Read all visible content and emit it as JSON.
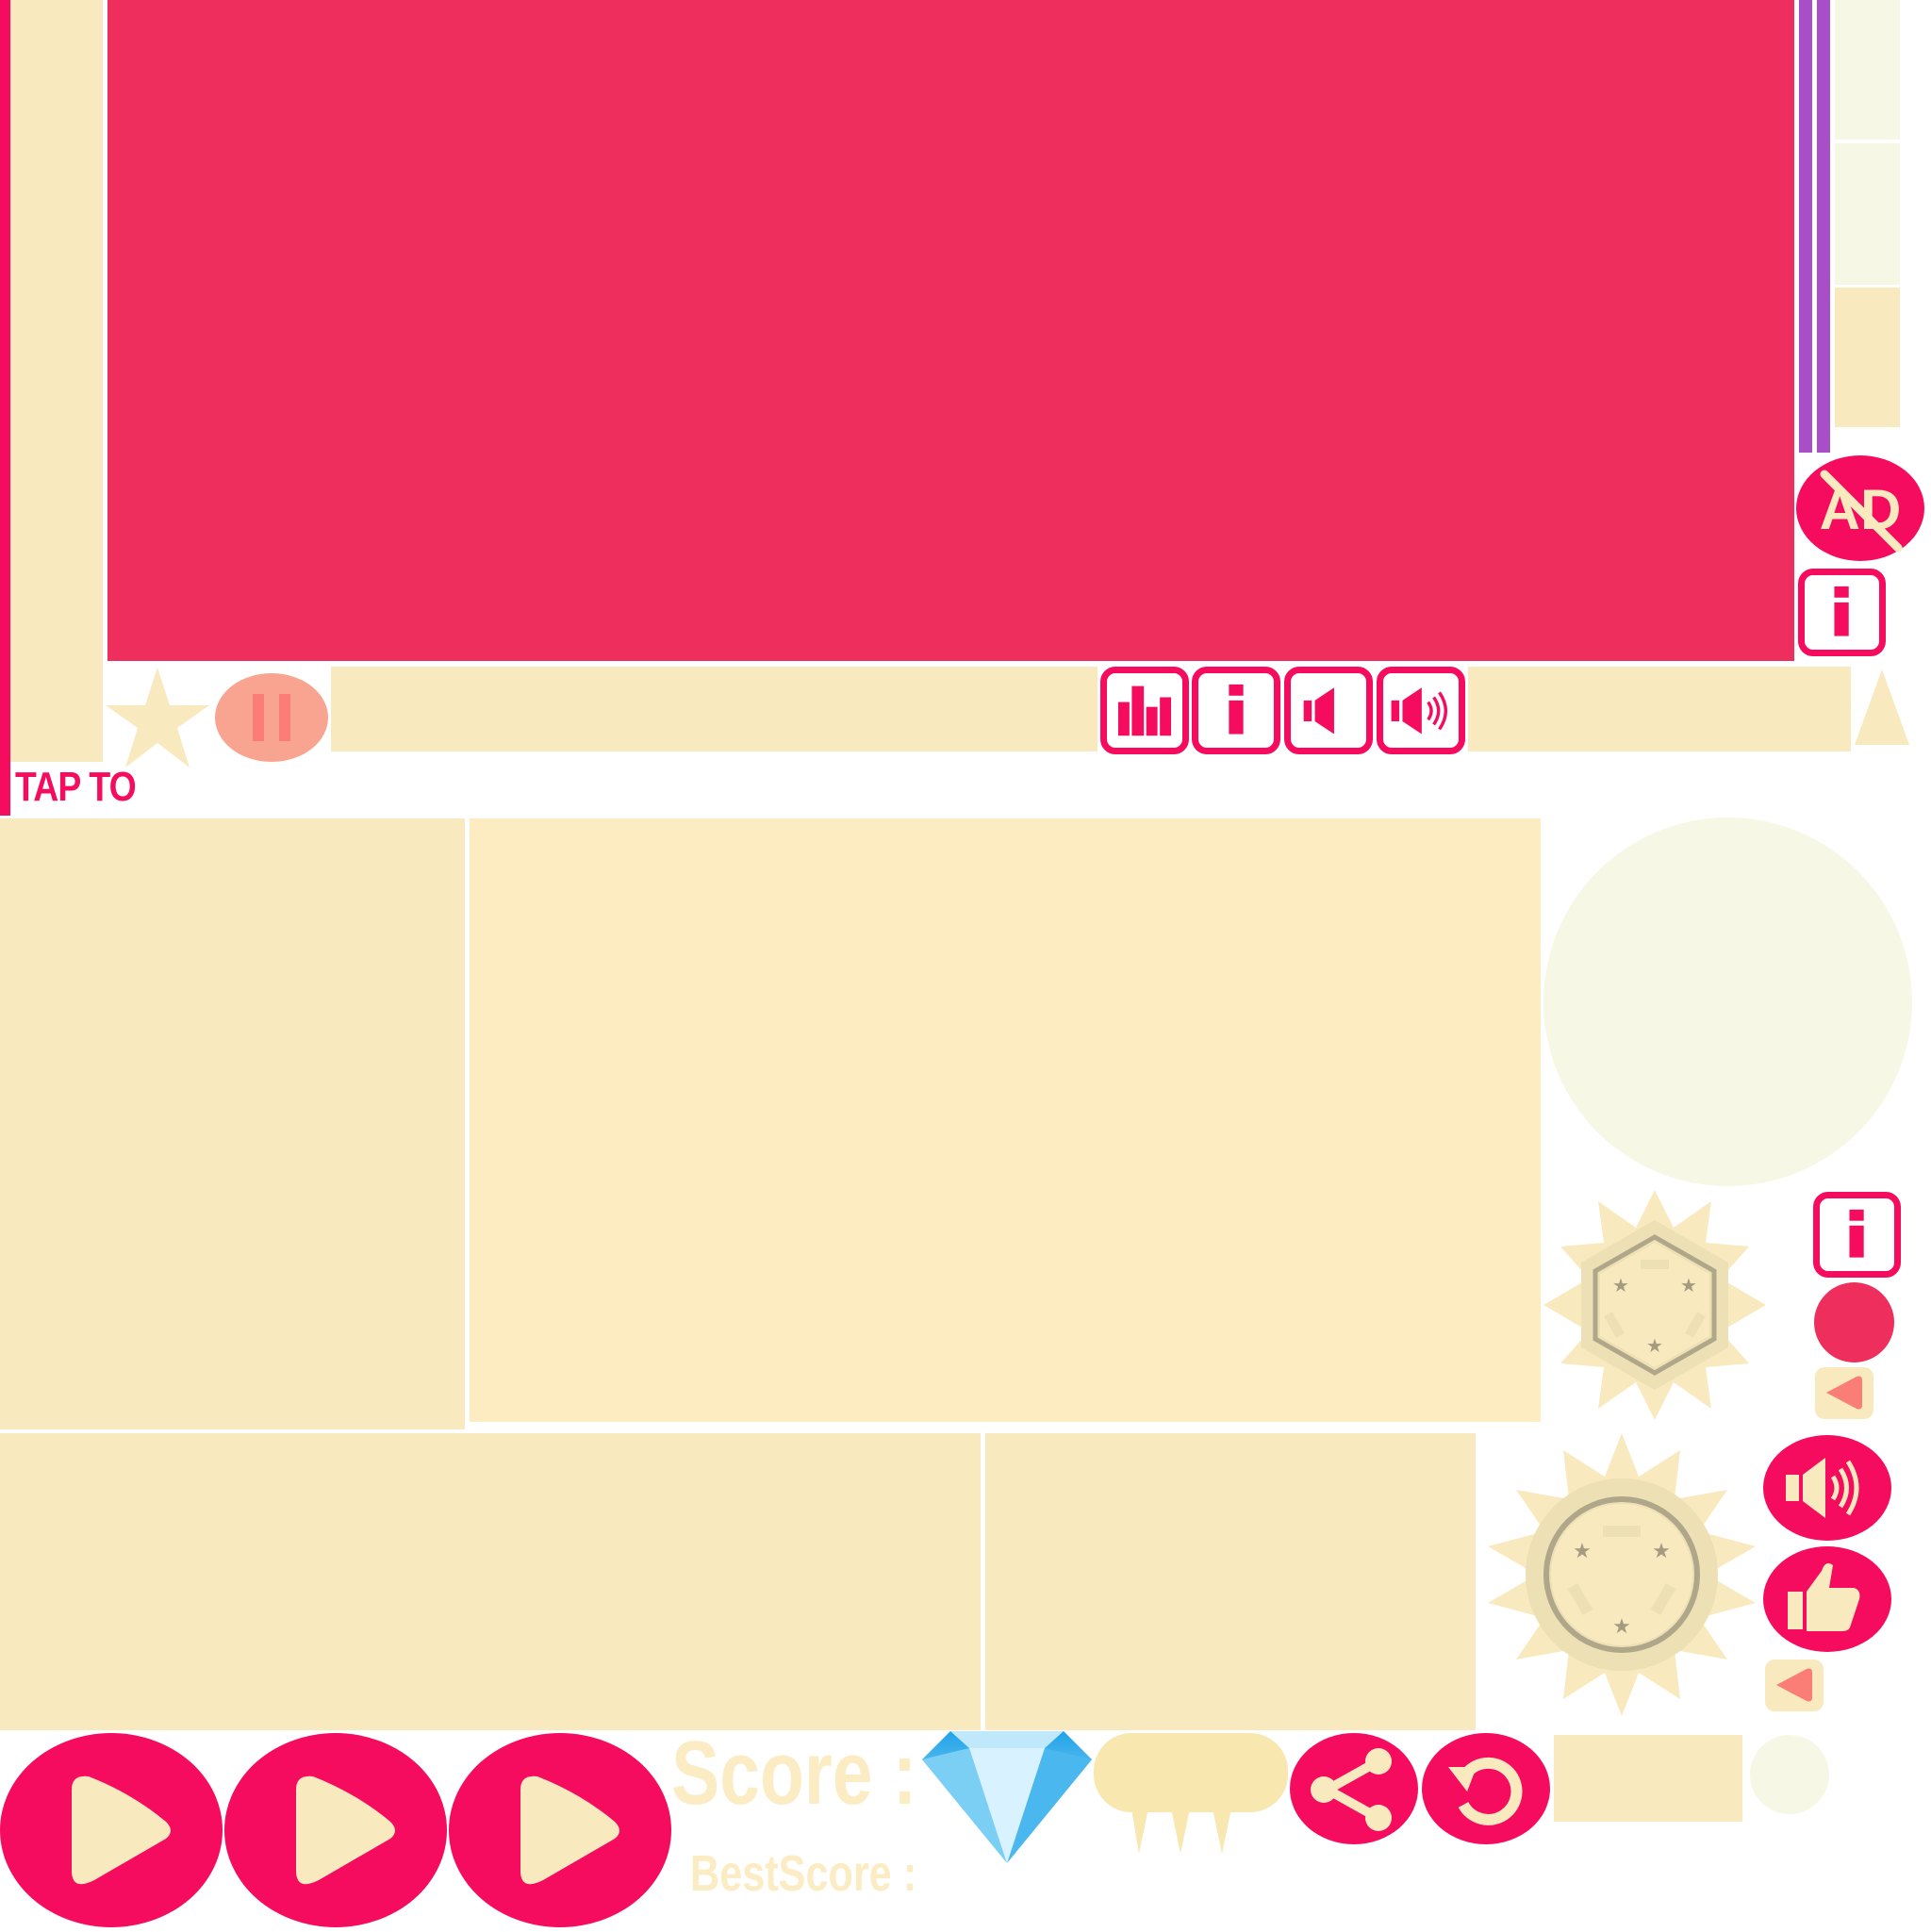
{
  "labels": {
    "tap_to": "TAP TO",
    "score": "Score :",
    "best_score": "BestScore :",
    "no_ads": "AD"
  },
  "icons": {
    "star": "star-icon",
    "pause": "pause-icon",
    "leaderboard": "leaderboard-icon",
    "info": "info-icon",
    "sound_off": "sound-off-icon",
    "sound_on": "sound-on-icon",
    "no_ads": "no-ads-icon",
    "play": "play-icon",
    "diamond": "diamond-icon",
    "share": "share-icon",
    "restart": "restart-icon",
    "like": "thumbs-up-icon",
    "back": "back-arrow-icon",
    "badge": "badge-icon"
  },
  "colors": {
    "primary_pink": "#f50c5f",
    "panel_red": "#ee2f5d",
    "cream": "#f8e9bf",
    "cream_light": "#fdecc1",
    "pale": "#f7f7e6",
    "purple": "#a84fc8",
    "salmon": "#f9a491",
    "diamond_blue": "#3fb6ef"
  }
}
